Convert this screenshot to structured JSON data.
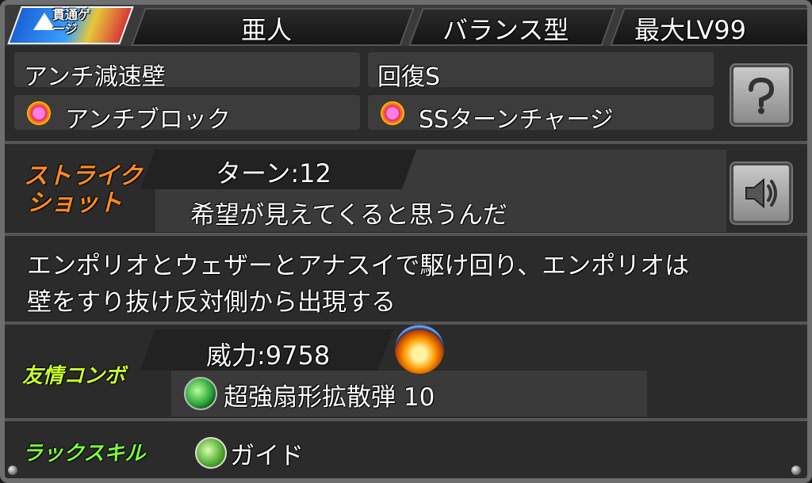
{
  "header": {
    "gauge_badge": "貫通ゲージ",
    "race": "亜人",
    "type": "バランス型",
    "max_level": "最大LV99"
  },
  "abilities": {
    "ability1": "アンチ減速壁",
    "ability2": "回復S",
    "gauge1": "アンチブロック",
    "gauge2": "SSターンチャージ",
    "help_icon": "question-icon"
  },
  "strike_shot": {
    "title_line1": "ストライク",
    "title_line2": "ショット",
    "turn_label": "ターン:12",
    "quote": "希望が見えてくると思うんだ",
    "voice_icon": "speaker-icon",
    "description_line1": "エンポリオとウェザーとアナスイで駆け回り、エンポリオは",
    "description_line2": "壁をすり抜け反対側から出現する"
  },
  "friend_combo": {
    "title": "友情コンボ",
    "power_label": "威力:9758",
    "name": "超強扇形拡散弾 10"
  },
  "luck_skill": {
    "title": "ラックスキル",
    "name": "ガイド"
  },
  "colors": {
    "strike_title": "#ff8a1c",
    "friend_title": "#c8ff2a",
    "luck_title": "#7dff3a"
  }
}
